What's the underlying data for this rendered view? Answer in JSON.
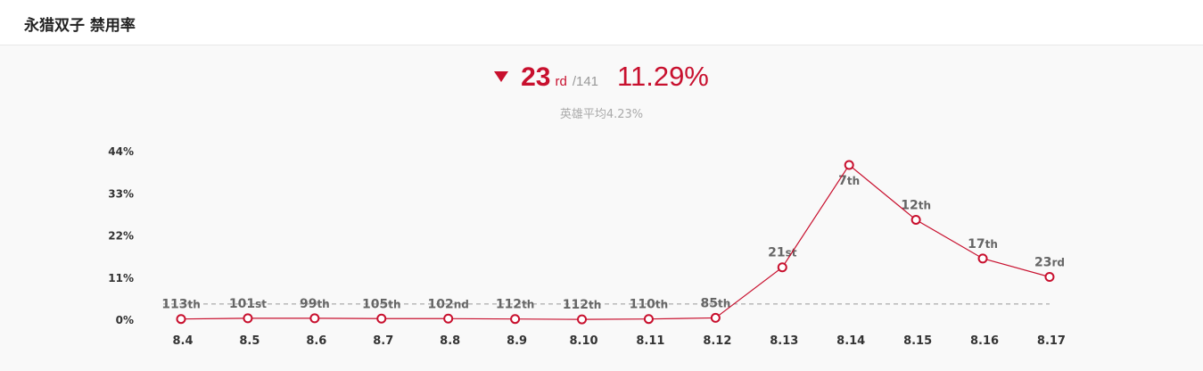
{
  "header": {
    "title": "永猎双子 禁用率"
  },
  "summary": {
    "rank": "23",
    "rank_suffix": "rd",
    "rank_total": "/141",
    "rate": "11.29%",
    "average_label": "英雄平均4.23%"
  },
  "colors": {
    "accent": "#c8102e",
    "text_dark": "#333333",
    "text_muted": "#999999",
    "average_line": "#999999"
  },
  "chart_data": {
    "type": "line",
    "title": "",
    "xlabel": "",
    "ylabel": "",
    "categories": [
      "8.4",
      "8.5",
      "8.6",
      "8.7",
      "8.8",
      "8.9",
      "8.10",
      "8.11",
      "8.12",
      "8.13",
      "8.14",
      "8.15",
      "8.16",
      "8.17"
    ],
    "series": [
      {
        "values": [
          0.3,
          0.5,
          0.5,
          0.4,
          0.4,
          0.3,
          0.2,
          0.3,
          0.6,
          13.8,
          40.5,
          26.2,
          16.1,
          11.29
        ],
        "data_labels": [
          {
            "num": "113",
            "suffix": "th"
          },
          {
            "num": "101",
            "suffix": "st"
          },
          {
            "num": "99",
            "suffix": "th"
          },
          {
            "num": "105",
            "suffix": "th"
          },
          {
            "num": "102",
            "suffix": "nd"
          },
          {
            "num": "112",
            "suffix": "th"
          },
          {
            "num": "112",
            "suffix": "th"
          },
          {
            "num": "110",
            "suffix": "th"
          },
          {
            "num": "85",
            "suffix": "th"
          },
          {
            "num": "21",
            "suffix": "st"
          },
          {
            "num": "7",
            "suffix": "th"
          },
          {
            "num": "12",
            "suffix": "th"
          },
          {
            "num": "17",
            "suffix": "th"
          },
          {
            "num": "23",
            "suffix": "rd"
          }
        ]
      }
    ],
    "average_value": 4.23,
    "y_ticks": [
      {
        "value": 0,
        "label": "0%"
      },
      {
        "value": 11,
        "label": "11%"
      },
      {
        "value": 22,
        "label": "22%"
      },
      {
        "value": 33,
        "label": "33%"
      },
      {
        "value": 44,
        "label": "44%"
      }
    ],
    "ylim": [
      0,
      44
    ],
    "grid": false,
    "legend": "none"
  }
}
